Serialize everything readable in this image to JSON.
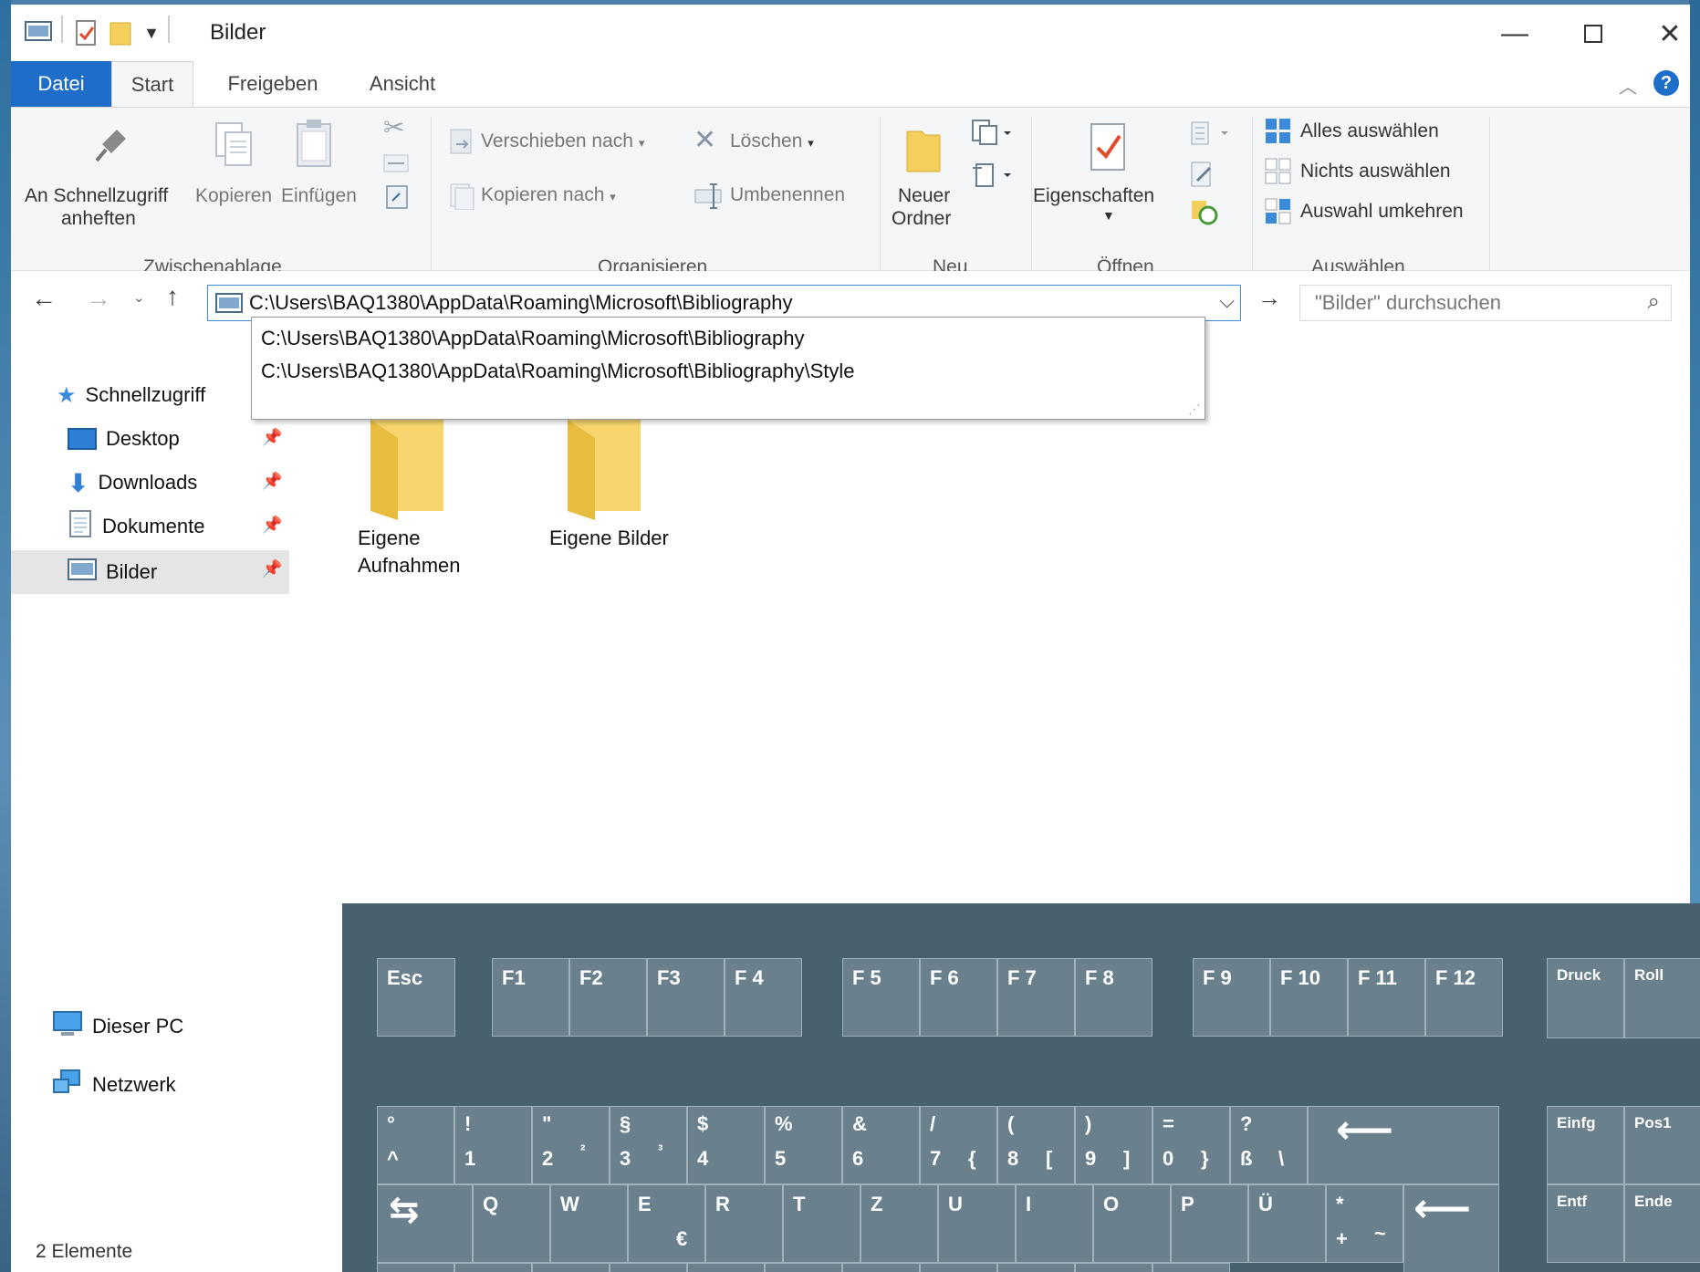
{
  "window": {
    "title": "Bilder"
  },
  "tabs": [
    "Datei",
    "Start",
    "Freigeben",
    "Ansicht"
  ],
  "ribbon": {
    "pin_line1": "An Schnellzugriff",
    "pin_line2": "anheften",
    "copy": "Kopieren",
    "paste": "Einfügen",
    "move_to": "Verschieben nach",
    "copy_to": "Kopieren nach",
    "delete": "Löschen",
    "rename": "Umbenennen",
    "new_folder_line1": "Neuer",
    "new_folder_line2": "Ordner",
    "properties": "Eigenschaften",
    "select_all": "Alles auswählen",
    "select_none": "Nichts auswählen",
    "invert_selection": "Auswahl umkehren",
    "groups": {
      "clipboard": "Zwischenablage",
      "organize": "Organisieren",
      "new": "Neu",
      "open": "Öffnen",
      "select": "Auswählen"
    }
  },
  "address": {
    "value": "C:\\Users\\BAQ1380\\AppData\\Roaming\\Microsoft\\Bibliography",
    "suggestions": [
      "C:\\Users\\BAQ1380\\AppData\\Roaming\\Microsoft\\Bibliography",
      "C:\\Users\\BAQ1380\\AppData\\Roaming\\Microsoft\\Bibliography\\Style"
    ]
  },
  "search": {
    "placeholder": "\"Bilder\" durchsuchen"
  },
  "nav": {
    "quick_access": "Schnellzugriff",
    "desktop": "Desktop",
    "downloads": "Downloads",
    "documents": "Dokumente",
    "pictures": "Bilder",
    "this_pc": "Dieser PC",
    "network": "Netzwerk"
  },
  "content": {
    "folders": [
      {
        "line1": "Eigene",
        "line2": "Aufnahmen"
      },
      {
        "line1": "Eigene Bilder",
        "line2": ""
      }
    ]
  },
  "status": {
    "items": "2 Elemente"
  },
  "keyboard": {
    "function_row": [
      "Esc",
      "F1",
      "F2",
      "F3",
      "F 4",
      "F 5",
      "F 6",
      "F 7",
      "F 8",
      "F 9",
      "F 10",
      "F 11",
      "F 12",
      "Druck",
      "Roll"
    ],
    "number_row": [
      {
        "top": "°",
        "bottom": "^",
        "alt": ""
      },
      {
        "top": "!",
        "bottom": "1",
        "alt": ""
      },
      {
        "top": "\"",
        "bottom": "2",
        "alt": "²"
      },
      {
        "top": "§",
        "bottom": "3",
        "alt": "³"
      },
      {
        "top": "$",
        "bottom": "4",
        "alt": ""
      },
      {
        "top": "%",
        "bottom": "5",
        "alt": ""
      },
      {
        "top": "&",
        "bottom": "6",
        "alt": ""
      },
      {
        "top": "/",
        "bottom": "7",
        "alt": "{"
      },
      {
        "top": "(",
        "bottom": "8",
        "alt": "["
      },
      {
        "top": ")",
        "bottom": "9",
        "alt": "]"
      },
      {
        "top": "=",
        "bottom": "0",
        "alt": "}"
      },
      {
        "top": "?",
        "bottom": "ß",
        "alt": "\\"
      }
    ],
    "qwertz_row": [
      {
        "top": "Q",
        "alt": ""
      },
      {
        "top": "W",
        "alt": ""
      },
      {
        "top": "E",
        "alt": "€"
      },
      {
        "top": "R",
        "alt": ""
      },
      {
        "top": "T",
        "alt": ""
      },
      {
        "top": "Z",
        "alt": ""
      },
      {
        "top": "U",
        "alt": ""
      },
      {
        "top": "I",
        "alt": ""
      },
      {
        "top": "O",
        "alt": ""
      },
      {
        "top": "P",
        "alt": ""
      },
      {
        "top": "Ü",
        "alt": ""
      },
      {
        "top": "*",
        "alt": "~",
        "bottom": "+"
      }
    ],
    "nav_keys": [
      "Einfg",
      "Pos1",
      "Entf",
      "Ende"
    ]
  },
  "colors": {
    "accent": "#1e6ec9",
    "keyboard_bg": "#47616f",
    "key_fill": "#6a818d"
  }
}
